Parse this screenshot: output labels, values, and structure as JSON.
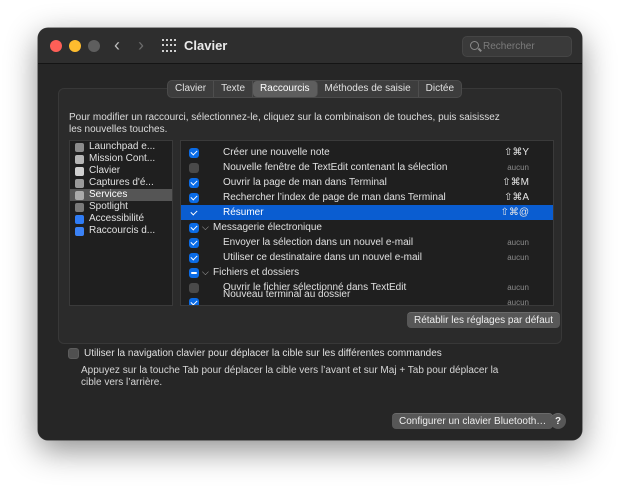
{
  "window": {
    "title": "Clavier"
  },
  "search": {
    "placeholder": "Rechercher"
  },
  "tabs": [
    {
      "label": "Clavier",
      "active": false
    },
    {
      "label": "Texte",
      "active": false
    },
    {
      "label": "Raccourcis",
      "active": true
    },
    {
      "label": "Méthodes de saisie",
      "active": false
    },
    {
      "label": "Dictée",
      "active": false
    }
  ],
  "instructions": "Pour modifier un raccourci, sélectionnez-le, cliquez sur la combinaison de touches, puis saisissez les nouvelles touches.",
  "sidebar": {
    "items": [
      {
        "label": "Launchpad e...",
        "icon": "launchpad-icon",
        "color": "#8c8c8c"
      },
      {
        "label": "Mission Cont...",
        "icon": "mission-control-icon",
        "color": "#b5b5b5"
      },
      {
        "label": "Clavier",
        "icon": "keyboard-icon",
        "color": "#cfcfcf"
      },
      {
        "label": "Captures d'é...",
        "icon": "screenshot-icon",
        "color": "#9a9a9a"
      },
      {
        "label": "Services",
        "icon": "gear-icon",
        "color": "#aaaaaa",
        "selected": true
      },
      {
        "label": "Spotlight",
        "icon": "spotlight-icon",
        "color": "#7a7a7a"
      },
      {
        "label": "Accessibilité",
        "icon": "accessibility-icon",
        "color": "#2f7cf6"
      },
      {
        "label": "Raccourcis d...",
        "icon": "app-shortcuts-icon",
        "color": "#3b82f6"
      }
    ]
  },
  "shortcuts": {
    "rows": [
      {
        "label": "Créer une nouvelle note",
        "key": "⇧⌘Y",
        "state": "on"
      },
      {
        "label": "Nouvelle fenêtre de TextEdit contenant la sélection",
        "key": "aucun",
        "state": "off"
      },
      {
        "label": "Ouvrir la page de man dans Terminal",
        "key": "⇧⌘M",
        "state": "on"
      },
      {
        "label": "Rechercher l’index de page de man dans Terminal",
        "key": "⇧⌘A",
        "state": "on"
      },
      {
        "label": "Résumer",
        "key": "⇧⌘@",
        "state": "on",
        "selected": true
      },
      {
        "label": "Messagerie électronique",
        "key": "",
        "state": "on",
        "group": true
      },
      {
        "label": "Envoyer la sélection dans un nouvel e-mail",
        "key": "aucun",
        "state": "on"
      },
      {
        "label": "Utiliser ce destinataire dans un nouvel e-mail",
        "key": "aucun",
        "state": "on"
      },
      {
        "label": "Fichiers et dossiers",
        "key": "",
        "state": "mixed",
        "group": true
      },
      {
        "label": "Ouvrir le fichier sélectionné dans TextEdit",
        "key": "aucun",
        "state": "off"
      },
      {
        "label": "Nouveau terminal au dossier",
        "key": "aucun",
        "state": "on",
        "cut": true
      }
    ]
  },
  "buttons": {
    "restore": "Rétablir les réglages par défaut",
    "bluetooth": "Configurer un clavier Bluetooth…",
    "help": "?"
  },
  "keyboard_nav": {
    "label": "Utiliser la navigation clavier pour déplacer la cible sur les différentes commandes",
    "help": "Appuyez sur la touche Tab pour déplacer la cible vers l’avant et sur Maj + Tab pour déplacer la cible vers l’arrière.",
    "checked": false
  }
}
